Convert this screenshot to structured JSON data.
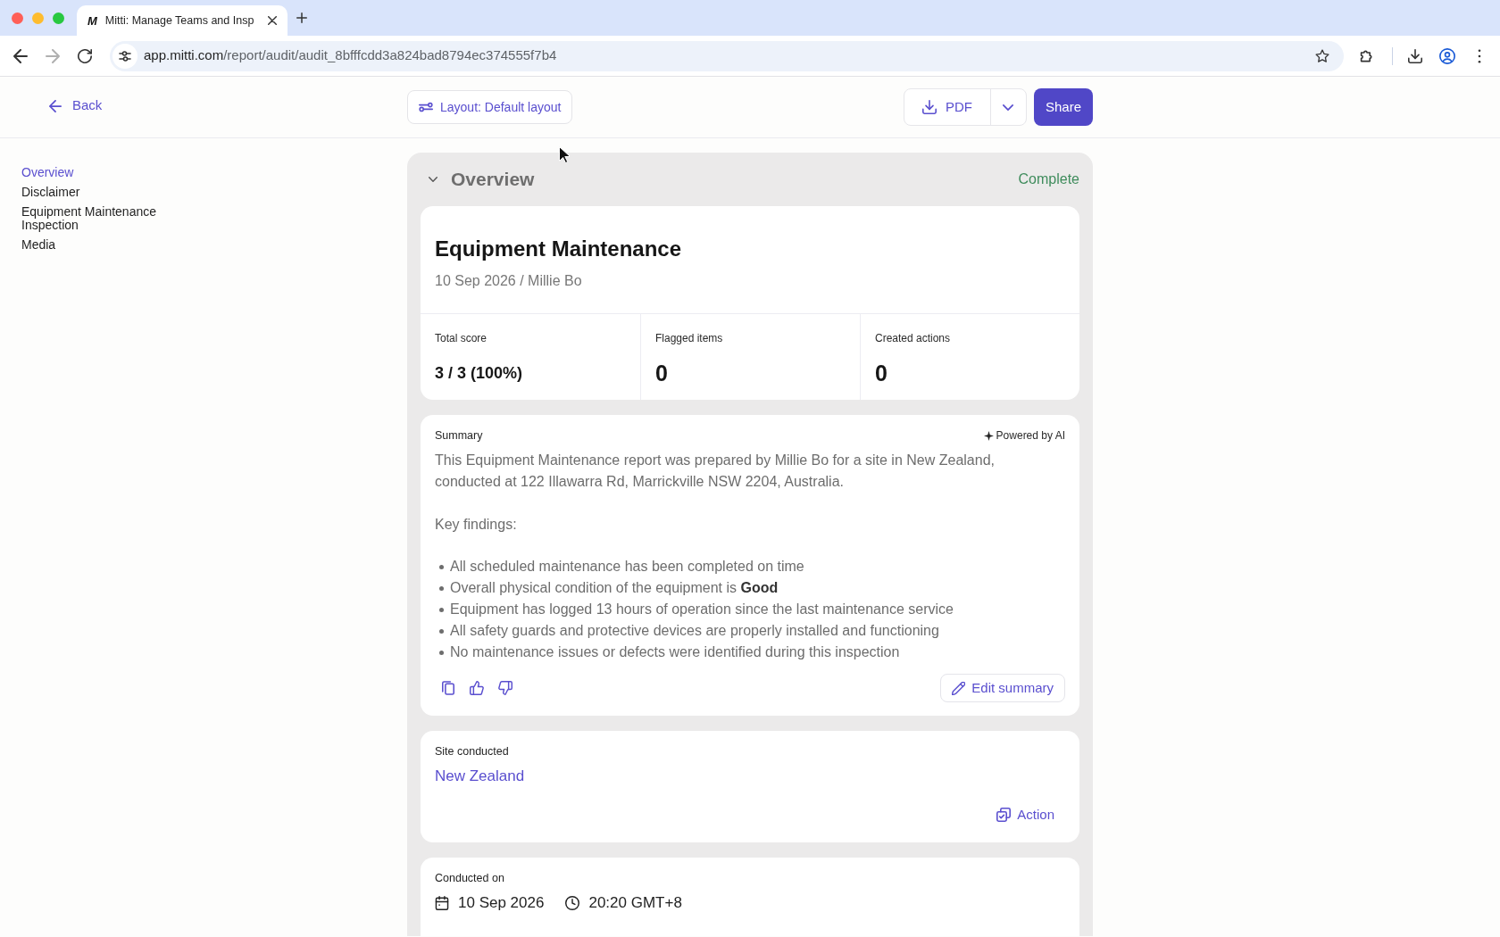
{
  "browser": {
    "tab_icon": "M",
    "tab_title": "Mitti: Manage Teams and Insp",
    "url_host": "app.mitti.com",
    "url_path": "/report/audit/audit_8bfffcdd3a824bad8794ec374555f7b4",
    "forward_disabled": true
  },
  "toolbar": {
    "back": "Back",
    "layout": "Layout: Default layout",
    "export": "PDF",
    "share": "Share"
  },
  "sidebar": {
    "items": [
      {
        "label": "Overview",
        "selected": true
      },
      {
        "label": "Disclaimer",
        "selected": false
      },
      {
        "label": "Equipment Maintenance Inspection",
        "selected": false
      },
      {
        "label": "Media",
        "selected": false
      }
    ]
  },
  "section": {
    "title": "Overview",
    "expanded": true,
    "status": "Complete"
  },
  "report": {
    "title": "Equipment Maintenance",
    "subtitle": "10 Sep 2026 / Millie Bo",
    "stats": [
      {
        "label": "Total score",
        "value": "3 / 3 (100%)",
        "kind": "score"
      },
      {
        "label": "Flagged items",
        "value": "0",
        "kind": "count"
      },
      {
        "label": "Created actions",
        "value": "0",
        "kind": "count"
      }
    ]
  },
  "summary": {
    "label": "Summary",
    "badge": "Powered by AI",
    "intro": "This Equipment Maintenance report was prepared by Millie Bo for a site in New Zealand, conducted at 122 Illawarra Rd, Marrickville NSW 2204, Australia.",
    "findings_title": "Key findings:",
    "findings": [
      "All scheduled maintenance has been completed on time",
      "Overall physical condition of the equipment is **Good**",
      "Equipment has logged 13 hours of operation since the last maintenance service",
      "All safety guards and protective devices are properly installed and functioning",
      "No maintenance issues or defects were identified during this inspection"
    ],
    "edit_label": "Edit summary"
  },
  "fields": [
    {
      "kind": "link",
      "label": "Site conducted",
      "value": "New Zealand",
      "action": "Action"
    },
    {
      "kind": "datetime",
      "label": "Conducted on",
      "date": "10 Sep 2026",
      "time": "20:20 GMT+8"
    }
  ]
}
